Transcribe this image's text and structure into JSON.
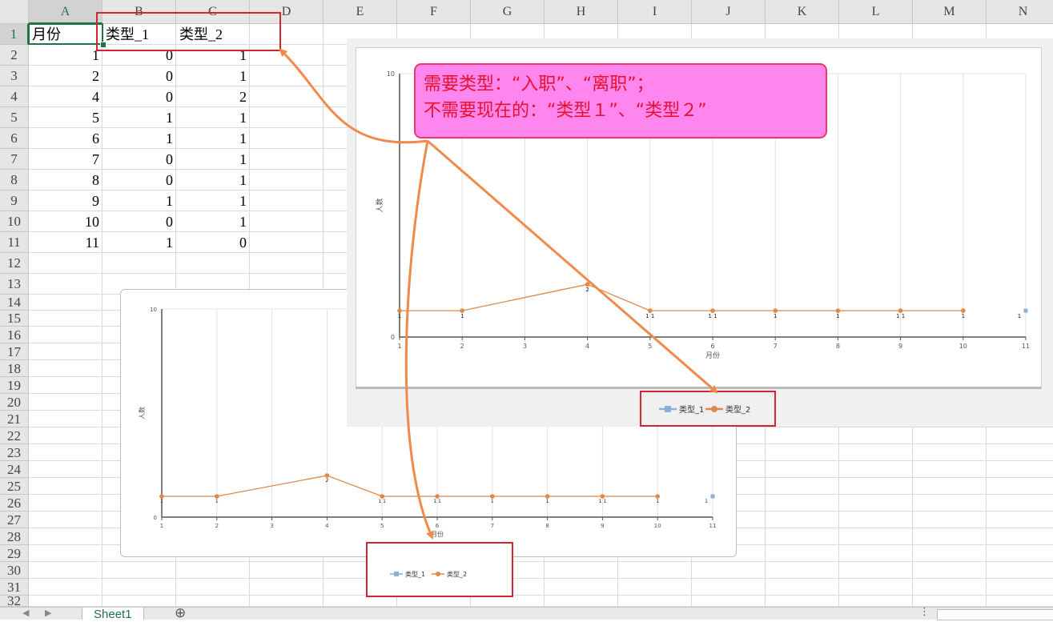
{
  "columns": [
    "A",
    "B",
    "C",
    "D",
    "E",
    "F",
    "G",
    "H",
    "I",
    "J",
    "K",
    "L",
    "M",
    "N"
  ],
  "rows": [
    "1",
    "2",
    "3",
    "4",
    "5",
    "6",
    "7",
    "8",
    "9",
    "10",
    "11",
    "12",
    "13",
    "14",
    "15",
    "16",
    "17",
    "18",
    "19",
    "20",
    "21",
    "22",
    "23",
    "24",
    "25",
    "26",
    "27",
    "28",
    "29",
    "30",
    "31",
    "32"
  ],
  "headers": {
    "a": "月份",
    "b": "类型_1",
    "c": "类型_2"
  },
  "table": [
    [
      "1",
      "0",
      "1"
    ],
    [
      "2",
      "0",
      "1"
    ],
    [
      "4",
      "0",
      "2"
    ],
    [
      "5",
      "1",
      "1"
    ],
    [
      "6",
      "1",
      "1"
    ],
    [
      "7",
      "0",
      "1"
    ],
    [
      "8",
      "0",
      "1"
    ],
    [
      "9",
      "1",
      "1"
    ],
    [
      "10",
      "0",
      "1"
    ],
    [
      "11",
      "1",
      "0"
    ]
  ],
  "callout": {
    "line1": "需要类型：“入职”、“离职”；",
    "line2": "不需要现在的：“类型１”、“类型２”"
  },
  "sheet_tab": "Sheet1",
  "colors": {
    "series1": "#8eaed6",
    "series2": "#e0874a",
    "annotation_red": "#d0262e",
    "callout_fill": "#ff86ee",
    "arrow": "#f08a4a",
    "accent": "#217346"
  },
  "chart_data": [
    {
      "type": "line",
      "x": [
        1,
        2,
        3,
        4,
        5,
        6,
        7,
        8,
        9,
        10,
        11
      ],
      "xlim": [
        1,
        11
      ],
      "ylim": [
        0,
        10
      ],
      "yticks": [
        0,
        10
      ],
      "xlabel": "月份",
      "ylabel": "人数",
      "series": [
        {
          "name": "类型_1",
          "points": [
            [
              11,
              1
            ]
          ],
          "color": "#8eaed6"
        },
        {
          "name": "类型_2",
          "points": [
            [
              1,
              1
            ],
            [
              2,
              1
            ],
            [
              4,
              2
            ],
            [
              5,
              1
            ],
            [
              6,
              1
            ],
            [
              7,
              1
            ],
            [
              8,
              1
            ],
            [
              9,
              1
            ],
            [
              10,
              1
            ]
          ],
          "color": "#e0874a"
        }
      ],
      "data_labels": [
        [
          1,
          "1"
        ],
        [
          2,
          "1"
        ],
        [
          4,
          "2"
        ],
        [
          5,
          "1 1"
        ],
        [
          6,
          "1 1"
        ],
        [
          7,
          "1"
        ],
        [
          8,
          "1"
        ],
        [
          9,
          "1 1"
        ],
        [
          10,
          "1"
        ],
        [
          11,
          "1"
        ]
      ],
      "legend": [
        "类型_1",
        "类型_2"
      ]
    },
    {
      "type": "line",
      "x": [
        1,
        2,
        3,
        4,
        5,
        6,
        7,
        8,
        9,
        10,
        11
      ],
      "xlim": [
        1,
        11
      ],
      "ylim": [
        0,
        10
      ],
      "yticks": [
        0,
        10
      ],
      "xlabel": "月份",
      "ylabel": "人数",
      "series": [
        {
          "name": "类型_1",
          "points": [
            [
              11,
              1
            ]
          ],
          "color": "#8eaed6"
        },
        {
          "name": "类型_2",
          "points": [
            [
              1,
              1
            ],
            [
              2,
              1
            ],
            [
              4,
              2
            ],
            [
              5,
              1
            ],
            [
              6,
              1
            ],
            [
              7,
              1
            ],
            [
              8,
              1
            ],
            [
              9,
              1
            ],
            [
              10,
              1
            ]
          ],
          "color": "#e0874a"
        }
      ],
      "data_labels": [
        [
          1,
          "1"
        ],
        [
          2,
          "1"
        ],
        [
          4,
          "2"
        ],
        [
          5,
          "1 1"
        ],
        [
          6,
          "1 1"
        ],
        [
          7,
          "1"
        ],
        [
          8,
          "1"
        ],
        [
          9,
          "1 1"
        ],
        [
          10,
          "1"
        ],
        [
          11,
          "1"
        ]
      ],
      "legend": [
        "类型_1",
        "类型_2"
      ]
    }
  ]
}
